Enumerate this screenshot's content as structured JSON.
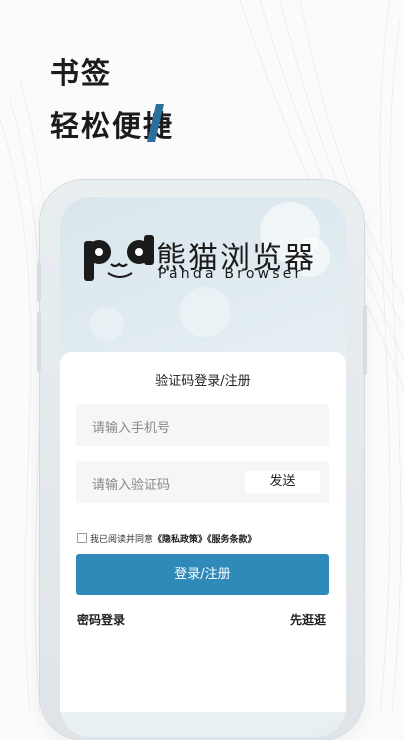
{
  "headline": {
    "line1": "书签",
    "line2": "轻松便捷"
  },
  "brand": {
    "name": "熊猫浏览器",
    "subtitle": "Panda Browser"
  },
  "form": {
    "title": "验证码登录/注册",
    "phone_placeholder": "请输入手机号",
    "code_placeholder": "请输入验证码",
    "send_label": "发送",
    "agree_prefix": "我已阅读并同意",
    "privacy_link": "《隐私政策》",
    "terms_link": "《服务条款》",
    "submit_label": "登录/注册",
    "password_login": "密码登录",
    "browse_first": "先逛逛"
  },
  "colors": {
    "primary": "#2f8ab9",
    "accent_slash": "#2b6f9c"
  }
}
